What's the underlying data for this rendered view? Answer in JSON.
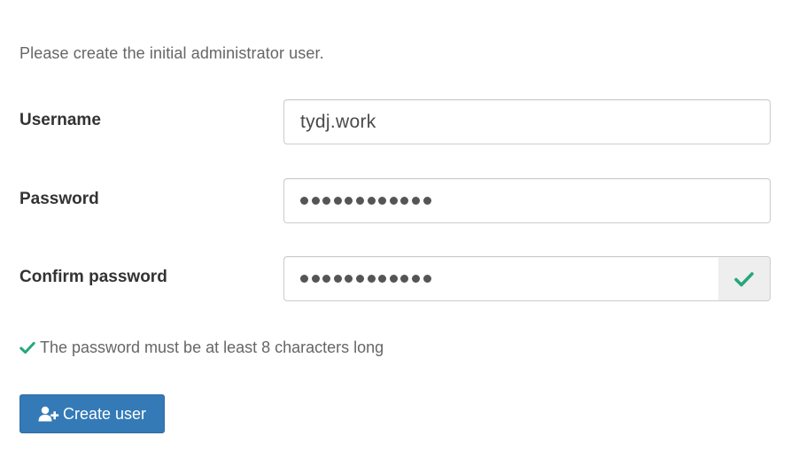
{
  "intro": {
    "text": "Please create the initial administrator user."
  },
  "form": {
    "username": {
      "label": "Username",
      "value": "tydj.work"
    },
    "password": {
      "label": "Password",
      "masked_length": 12
    },
    "confirm_password": {
      "label": "Confirm password",
      "masked_length": 12,
      "status_icon": "check-icon"
    }
  },
  "validation": {
    "icon": "check-icon",
    "message": "The password must be at least 8 characters long"
  },
  "actions": {
    "create_user": {
      "icon": "user-plus-icon",
      "label": "Create user"
    }
  },
  "colors": {
    "primary": "#337ab7",
    "success": "#26a77a",
    "muted_text": "#666666",
    "label_text": "#333333"
  }
}
